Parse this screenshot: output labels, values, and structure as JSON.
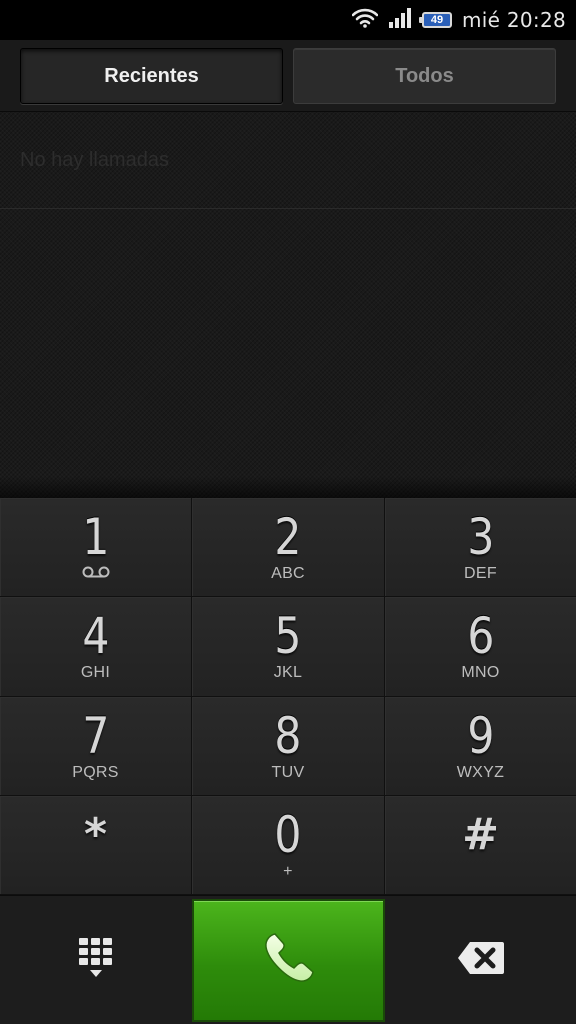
{
  "status_bar": {
    "battery_level": "49",
    "clock": "mié 20:28",
    "icons": [
      "wifi-icon",
      "signal-icon",
      "battery-icon"
    ]
  },
  "tabs": [
    {
      "label": "Recientes",
      "active": true
    },
    {
      "label": "Todos",
      "active": false
    }
  ],
  "call_log": {
    "empty_text": "No hay llamadas"
  },
  "dialpad": {
    "keys": [
      {
        "digit": "1",
        "letters": ""
      },
      {
        "digit": "2",
        "letters": "ABC"
      },
      {
        "digit": "3",
        "letters": "DEF"
      },
      {
        "digit": "4",
        "letters": "GHI"
      },
      {
        "digit": "5",
        "letters": "JKL"
      },
      {
        "digit": "6",
        "letters": "MNO"
      },
      {
        "digit": "7",
        "letters": "PQRS"
      },
      {
        "digit": "8",
        "letters": "TUV"
      },
      {
        "digit": "9",
        "letters": "WXYZ"
      },
      {
        "digit": "*",
        "letters": ""
      },
      {
        "digit": "0",
        "letters": "+"
      },
      {
        "digit": "#",
        "letters": ""
      }
    ]
  },
  "actions": {
    "call_color": "#2e8c0b",
    "icons": [
      "keypad-toggle-icon",
      "phone-icon",
      "backspace-icon"
    ]
  }
}
